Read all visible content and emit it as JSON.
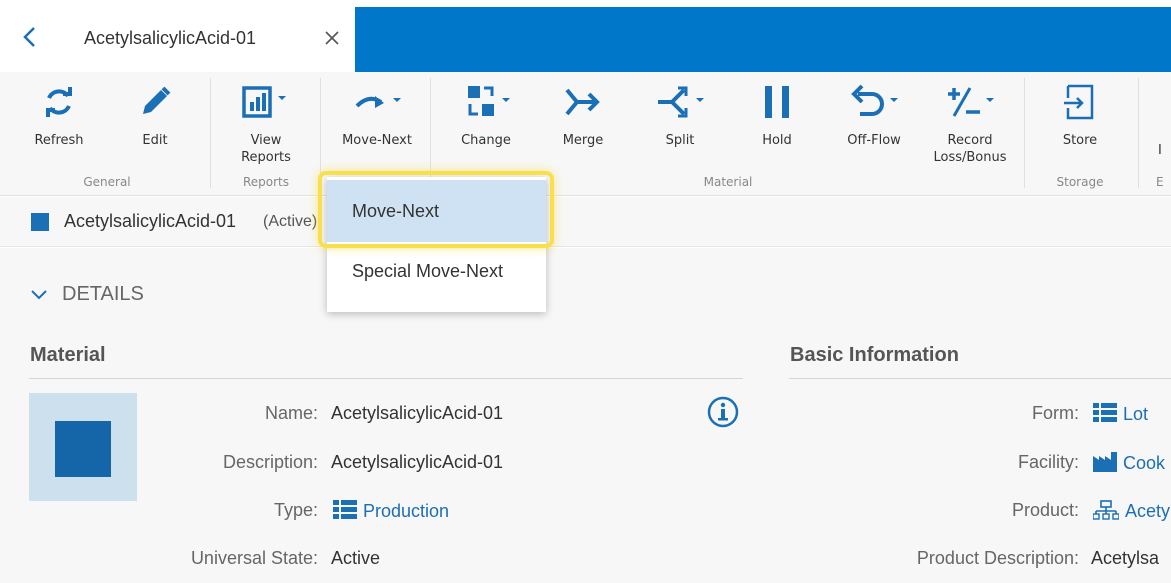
{
  "tab": {
    "title": "AcetylsalicylicAcid-01"
  },
  "ribbon": {
    "buttons": {
      "refresh": "Refresh",
      "edit": "Edit",
      "view_reports": "View Reports",
      "move_next": "Move-Next",
      "change": "Change",
      "merge": "Merge",
      "split": "Split",
      "hold": "Hold",
      "off_flow": "Off-Flow",
      "record_loss_bonus": "Record Loss/Bonus",
      "store": "Store",
      "partial": "I"
    },
    "groups": {
      "general": "General",
      "reports": "Reports",
      "material": "Material",
      "storage": "Storage",
      "partial": "E"
    },
    "accent_color": "#0077c8"
  },
  "entity": {
    "name": "AcetylsalicylicAcid-01",
    "state": "(Active)"
  },
  "dropdown": {
    "items": [
      "Move-Next",
      "Special Move-Next"
    ],
    "selected_index": 0
  },
  "details": {
    "toggle_label": "DETAILS",
    "material": {
      "title": "Material",
      "fields": [
        {
          "label": "Name:",
          "value": "AcetylsalicylicAcid-01"
        },
        {
          "label": "Description:",
          "value": "AcetylsalicylicAcid-01"
        },
        {
          "label": "Type:",
          "value": "Production"
        },
        {
          "label": "Universal State:",
          "value": "Active"
        }
      ]
    },
    "basic_info": {
      "title": "Basic Information",
      "fields": [
        {
          "label": "Form:",
          "value": "Lot"
        },
        {
          "label": "Facility:",
          "value": "Cook"
        },
        {
          "label": "Product:",
          "value": "Acety"
        },
        {
          "label": "Product Description:",
          "value": "Acetylsa"
        }
      ]
    }
  }
}
